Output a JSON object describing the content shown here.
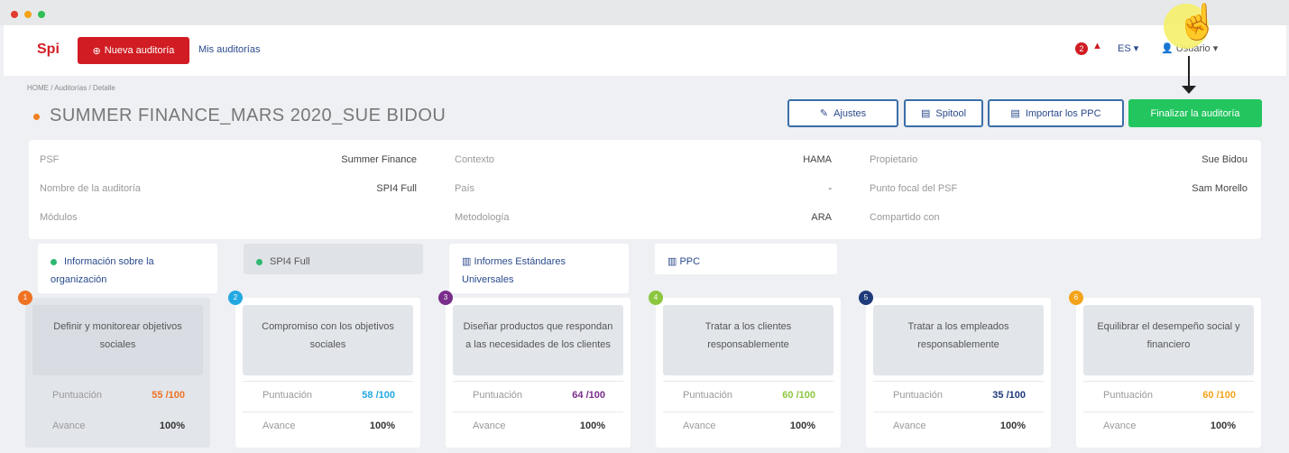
{
  "window": {
    "dots": [
      "#e03b2e",
      "#f3a319",
      "#2fbf55"
    ]
  },
  "header": {
    "logo": "Spi",
    "new_audit_button": "Nueva auditoría",
    "my_audits_link": "Mis auditorías",
    "notifications_count": "2",
    "language": "ES",
    "user_name": "Usuario"
  },
  "breadcrumb": "HOME / Auditorías / Detalle",
  "page_title": "SUMMER FINANCE_MARS 2020_SUE BIDOU",
  "actions": {
    "settings": "Ajustes",
    "spitool": "Spitool",
    "import_ppc": "Importar los PPC",
    "finalize": "Finalizar la auditoría"
  },
  "info": {
    "col1": [
      {
        "label": "PSF",
        "value": "Summer Finance"
      },
      {
        "label": "Nombre de la auditoría",
        "value": "SPI4 Full"
      },
      {
        "label": "Módulos",
        "value": ""
      }
    ],
    "col2": [
      {
        "label": "Contexto",
        "value": "HAMA"
      },
      {
        "label": "País",
        "value": "-"
      },
      {
        "label": "Metodología",
        "value": "ARA"
      }
    ],
    "col3": [
      {
        "label": "Propietario",
        "value": "Sue Bidou"
      },
      {
        "label": "Punto focal del PSF",
        "value": "Sam Morello"
      },
      {
        "label": "Compartido con",
        "value": ""
      }
    ]
  },
  "tabs": [
    {
      "label": "Información sobre la organización"
    },
    {
      "label": "SPI4 Full"
    },
    {
      "label": "Informes Estándares Universales"
    },
    {
      "label": "PPC"
    }
  ],
  "cards": [
    {
      "num": "1",
      "color": "#f07223",
      "title": "Definir y monitorear objetivos sociales",
      "score_label": "Puntuación",
      "score": "55 /100",
      "score_color": "#f07223",
      "progress_label": "Avance",
      "progress": "100%"
    },
    {
      "num": "2",
      "color": "#23a9e1",
      "title": "Compromiso con los objetivos sociales",
      "score_label": "Puntuación",
      "score": "58 /100",
      "score_color": "#23a9e1",
      "progress_label": "Avance",
      "progress": "100%"
    },
    {
      "num": "3",
      "color": "#7a2e8c",
      "title": "Diseñar productos que respondan a las necesidades de los clientes",
      "score_label": "Puntuación",
      "score": "64 /100",
      "score_color": "#7a2e8c",
      "progress_label": "Avance",
      "progress": "100%"
    },
    {
      "num": "4",
      "color": "#8cc63f",
      "title": "Tratar a los clientes responsablemente",
      "score_label": "Puntuación",
      "score": "60 /100",
      "score_color": "#8cc63f",
      "progress_label": "Avance",
      "progress": "100%"
    },
    {
      "num": "5",
      "color": "#1f3a7a",
      "title": "Tratar a los empleados responsablemente",
      "score_label": "Puntuación",
      "score": "35 /100",
      "score_color": "#1f3a7a",
      "progress_label": "Avance",
      "progress": "100%"
    },
    {
      "num": "6",
      "color": "#f3a319",
      "title": "Equilibrar el desempeño social y financiero",
      "score_label": "Puntuación",
      "score": "60 /100",
      "score_color": "#f3a319",
      "progress_label": "Avance",
      "progress": "100%"
    }
  ]
}
